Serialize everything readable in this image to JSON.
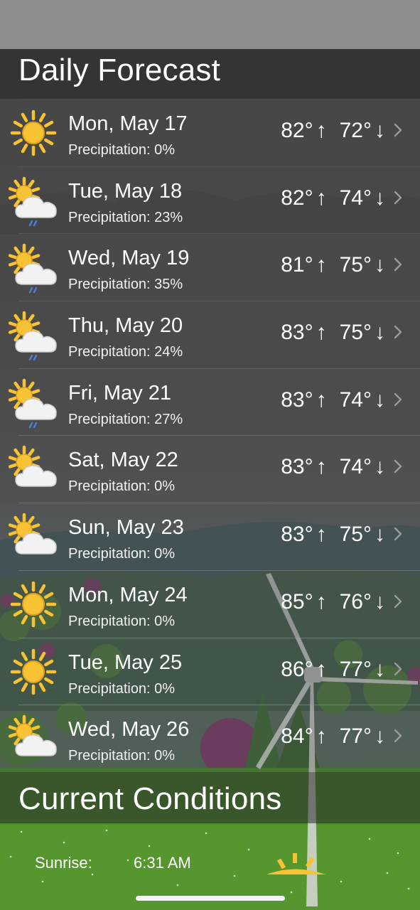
{
  "daily_forecast": {
    "title": "Daily Forecast",
    "days": [
      {
        "date": "Mon, May 17",
        "precipitation": "Precipitation: 0%",
        "high": "82°",
        "low": "72°",
        "icon": "sun-icon"
      },
      {
        "date": "Tue, May 18",
        "precipitation": "Precipitation: 23%",
        "high": "82°",
        "low": "74°",
        "icon": "partly-cloudy-rain-icon"
      },
      {
        "date": "Wed, May 19",
        "precipitation": "Precipitation: 35%",
        "high": "81°",
        "low": "75°",
        "icon": "partly-cloudy-rain-icon"
      },
      {
        "date": "Thu, May 20",
        "precipitation": "Precipitation: 24%",
        "high": "83°",
        "low": "75°",
        "icon": "partly-cloudy-rain-icon"
      },
      {
        "date": "Fri, May 21",
        "precipitation": "Precipitation: 27%",
        "high": "83°",
        "low": "74°",
        "icon": "partly-cloudy-rain-icon"
      },
      {
        "date": "Sat, May 22",
        "precipitation": "Precipitation: 0%",
        "high": "83°",
        "low": "74°",
        "icon": "partly-cloudy-icon"
      },
      {
        "date": "Sun, May 23",
        "precipitation": "Precipitation: 0%",
        "high": "83°",
        "low": "75°",
        "icon": "partly-cloudy-icon"
      },
      {
        "date": "Mon, May 24",
        "precipitation": "Precipitation: 0%",
        "high": "85°",
        "low": "76°",
        "icon": "sun-icon"
      },
      {
        "date": "Tue, May 25",
        "precipitation": "Precipitation: 0%",
        "high": "86°",
        "low": "77°",
        "icon": "sun-icon"
      },
      {
        "date": "Wed, May 26",
        "precipitation": "Precipitation: 0%",
        "high": "84°",
        "low": "77°",
        "icon": "partly-cloudy-icon"
      }
    ],
    "up_arrow": "↑",
    "down_arrow": "↓"
  },
  "current_conditions": {
    "title": "Current Conditions",
    "sunrise_label": "Sunrise:",
    "sunrise_value": "6:31 AM"
  },
  "colors": {
    "row_background": "#474747",
    "sun": "#f7c234",
    "sun_outline": "#e0a21c",
    "cloud": "#f2f2f2",
    "rain": "#4a7fe0",
    "grass": "#4a8a2c"
  }
}
